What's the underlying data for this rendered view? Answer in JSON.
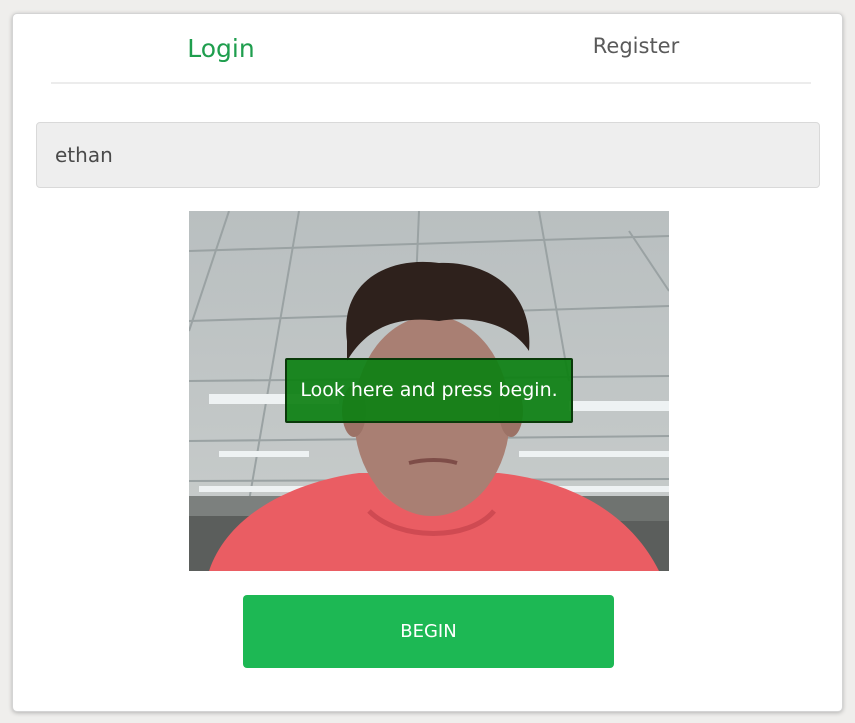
{
  "tabs": {
    "login_label": "Login",
    "register_label": "Register",
    "active": "login"
  },
  "login_form": {
    "username_value": "ethan"
  },
  "camera": {
    "overlay_message": "Look here and press begin."
  },
  "actions": {
    "begin_label": "BEGIN"
  },
  "colors": {
    "accent": "#1f9e4e",
    "button": "#1db854",
    "overlay": "#0d8012"
  }
}
